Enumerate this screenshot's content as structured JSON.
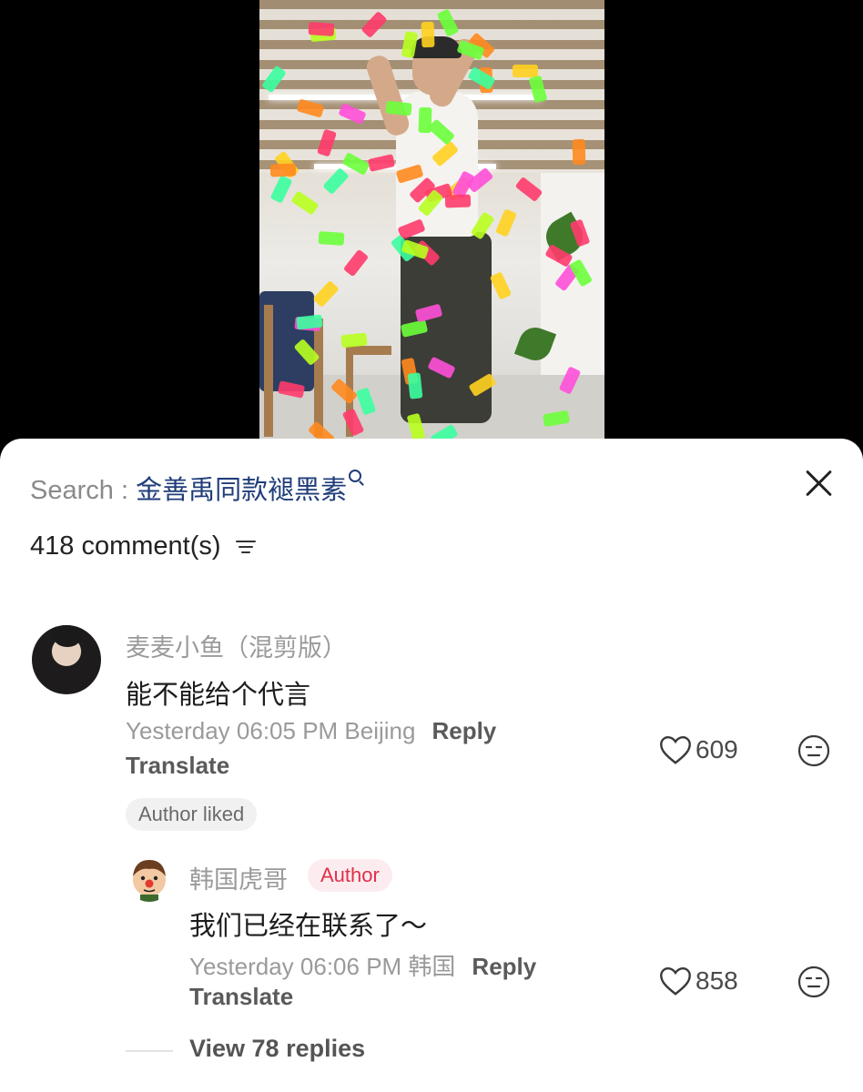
{
  "comments_panel": {
    "search_prefix": "Search : ",
    "search_query": "金善禹同款褪黑素",
    "comment_count_label": "418 comment(s)"
  },
  "comment": {
    "username": "麦麦小鱼（混剪版）",
    "text": "能不能给个代言",
    "meta": "Yesterday 06:05 PM Beijing",
    "reply_label": "Reply",
    "translate_label": "Translate",
    "likes": "609",
    "author_liked_label": "Author liked"
  },
  "reply": {
    "username": "韩国虎哥",
    "author_badge": "Author",
    "text": "我们已经在联系了～",
    "meta": "Yesterday 06:06 PM 韩国",
    "reply_label": "Reply",
    "translate_label": "Translate",
    "likes": "858"
  },
  "view_replies_label": "View 78 replies",
  "colors": {
    "search_query": "#1f3d7a",
    "author_badge_text": "#e02f4a",
    "author_badge_bg": "#fdecef"
  }
}
